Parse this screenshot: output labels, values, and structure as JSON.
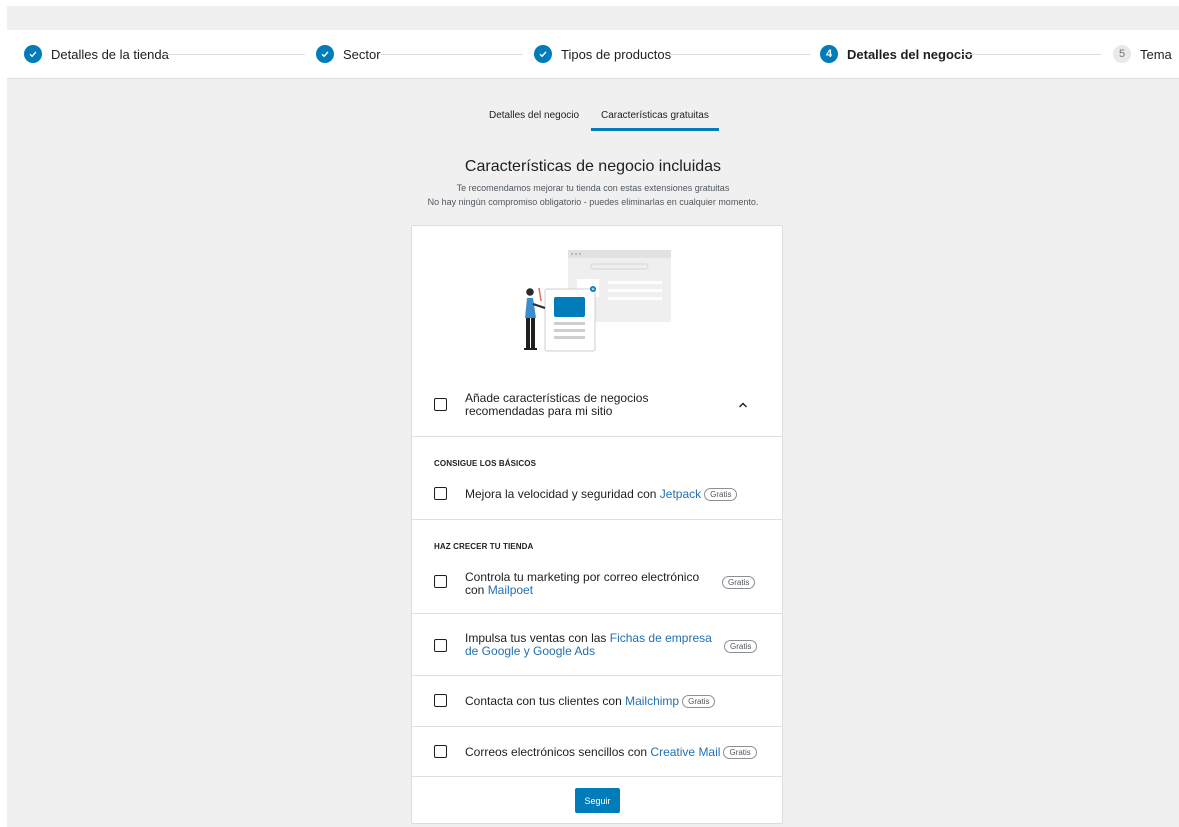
{
  "colors": {
    "accent": "#007cba",
    "link": "#2271b1",
    "background": "#f0f0f1"
  },
  "stepper": {
    "steps": [
      {
        "label": "Detalles de la tienda",
        "state": "complete",
        "icon": "check-icon"
      },
      {
        "label": "Sector",
        "state": "complete",
        "icon": "check-icon"
      },
      {
        "label": "Tipos de productos",
        "state": "complete",
        "icon": "check-icon"
      },
      {
        "label": "Detalles del negocio",
        "state": "current",
        "number": "4"
      },
      {
        "label": "Tema",
        "state": "pending",
        "number": "5"
      }
    ]
  },
  "tabs": [
    {
      "label": "Detalles del negocio",
      "active": false
    },
    {
      "label": "Características gratuitas",
      "active": true
    }
  ],
  "header": {
    "title": "Características de negocio incluidas",
    "subtitle_1": "Te recomendamos mejorar tu tienda con estas extensiones gratuitas",
    "subtitle_2": "No hay ningún compromiso obligatorio - puedes eliminarlas en cualquier momento."
  },
  "card": {
    "main_option": {
      "label": "Añade características de negocios recomendadas para mi sitio",
      "checked": false,
      "expanded": true
    },
    "sections": [
      {
        "title": "CONSIGUE LOS BÁSICOS",
        "items": [
          {
            "text": "Mejora la velocidad y seguridad con ",
            "link": "Jetpack",
            "badge": "Gratis",
            "checked": false
          }
        ]
      },
      {
        "title": "HAZ CRECER TU TIENDA",
        "items": [
          {
            "text": "Controla tu marketing por correo electrónico con ",
            "link": "Mailpoet",
            "badge": "Gratis",
            "checked": false
          },
          {
            "text": "Impulsa tus ventas con las ",
            "link": "Fichas de empresa de Google y Google Ads",
            "badge": "Gratis",
            "checked": false
          },
          {
            "text": "Contacta con tus clientes con ",
            "link": "Mailchimp",
            "badge": "Gratis",
            "checked": false
          },
          {
            "text": "Correos electrónicos sencillos con ",
            "link": "Creative Mail",
            "badge": "Gratis",
            "checked": false
          }
        ]
      }
    ],
    "continue_label": "Seguir"
  }
}
